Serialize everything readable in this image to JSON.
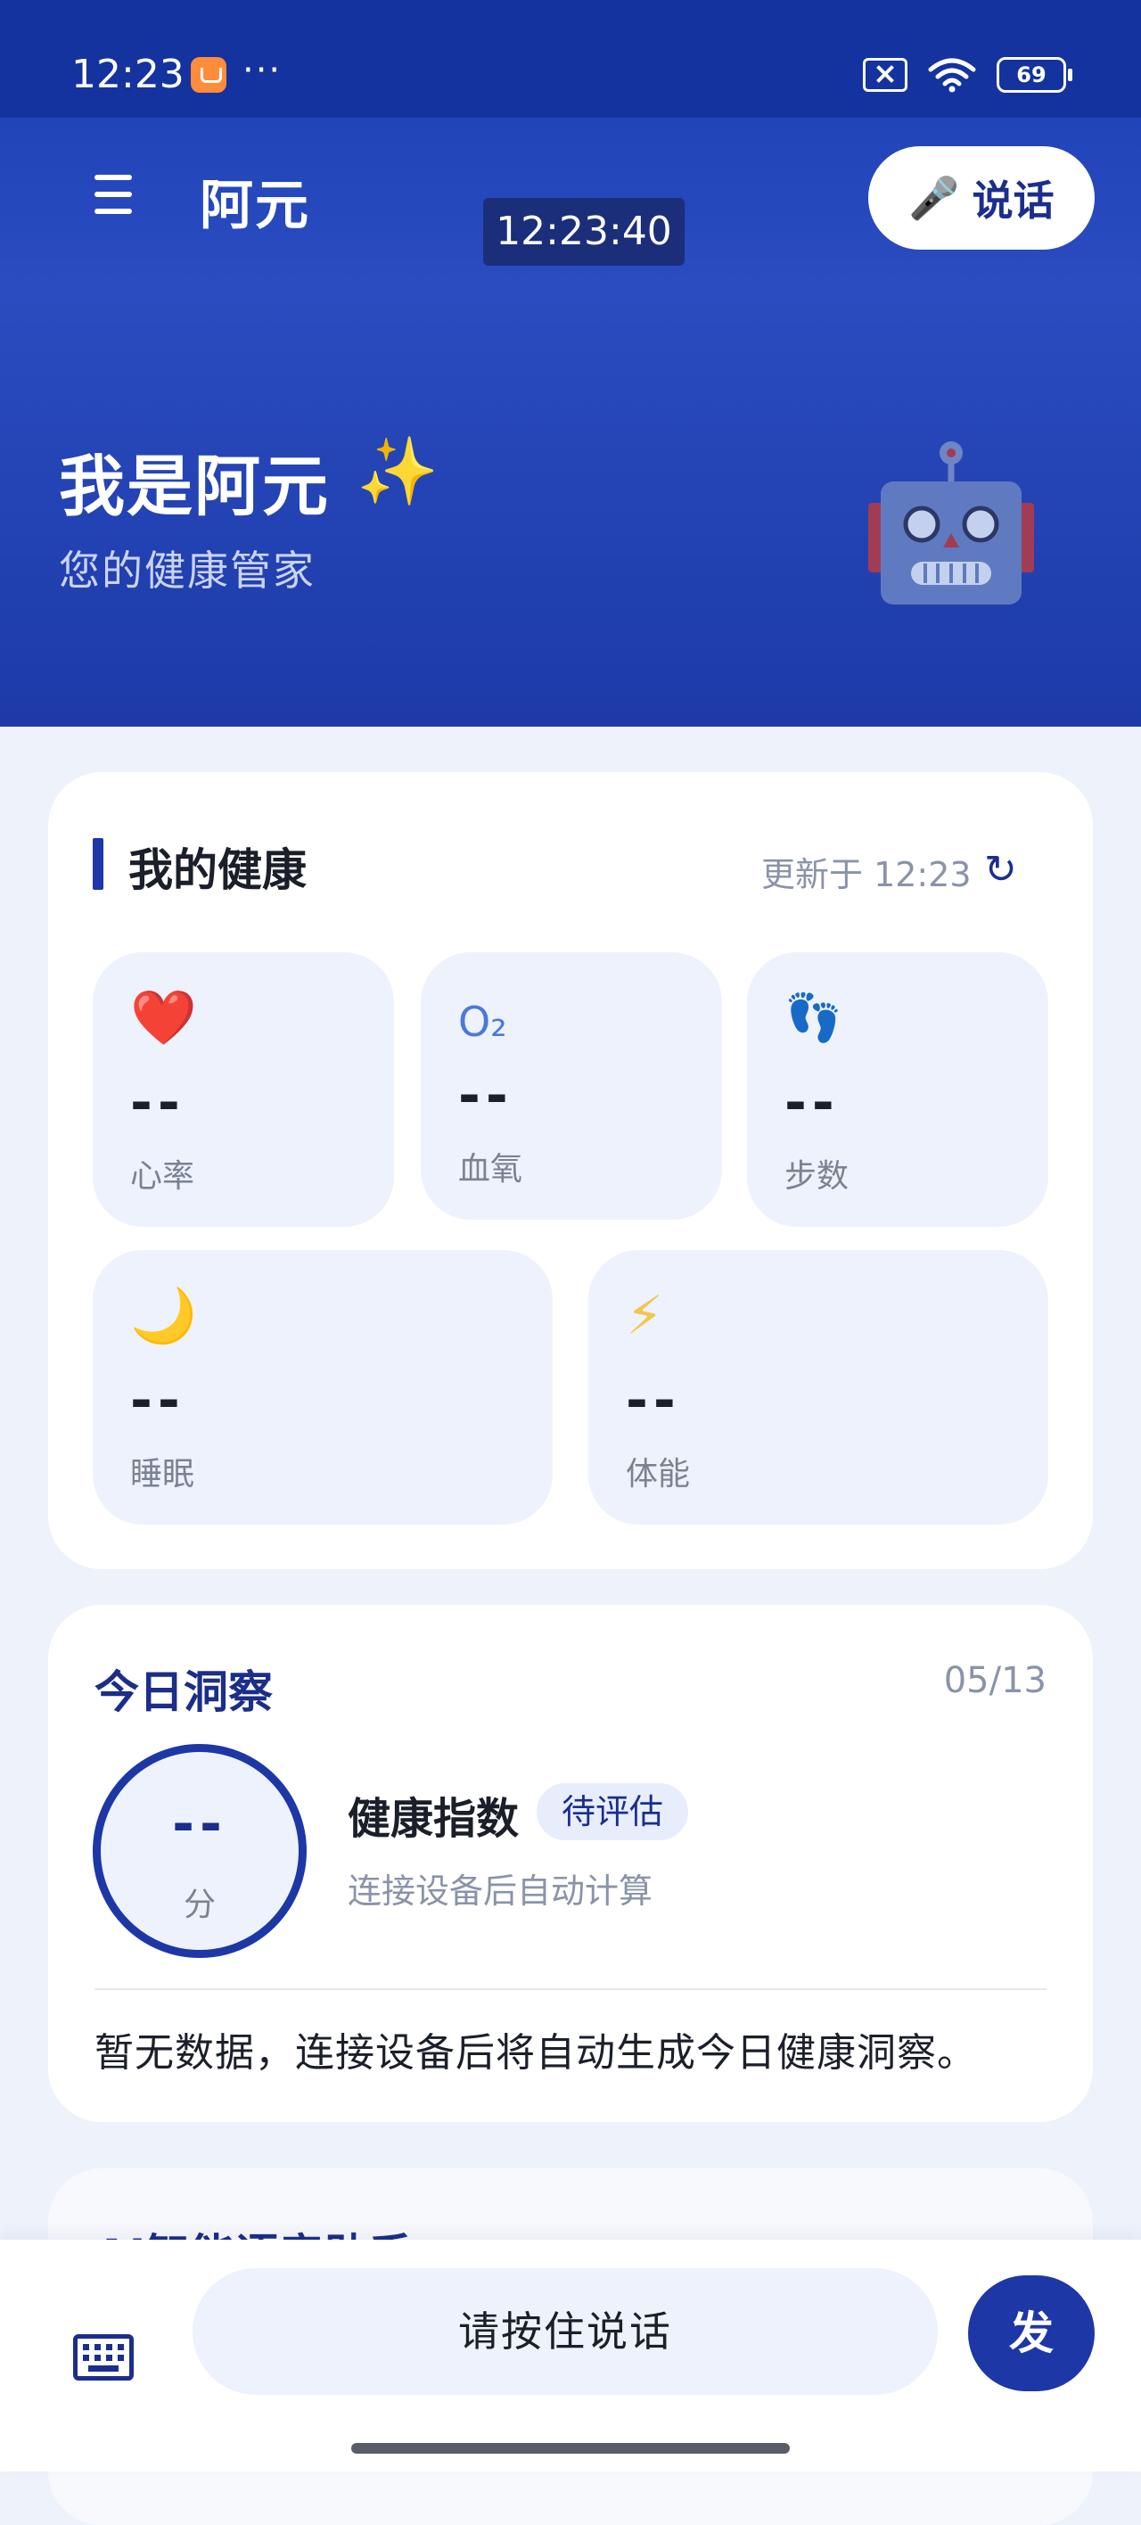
{
  "status_bar": {
    "time": "12:23",
    "dots": "···",
    "battery": "69"
  },
  "header": {
    "title": "阿元",
    "clock": "12:23:40",
    "talk_label": "说话"
  },
  "hero": {
    "title": "我是阿元",
    "sparkle": "✨",
    "subtitle": "您的健康管家"
  },
  "health": {
    "title": "我的健康",
    "updated": "更新于 12:23",
    "refresh_glyph": "↻",
    "metrics": [
      {
        "icon": "❤️",
        "value": "--",
        "label": "心率"
      },
      {
        "icon": "O₂",
        "value": "--",
        "label": "血氧"
      },
      {
        "icon": "👣",
        "value": "--",
        "label": "步数"
      },
      {
        "icon": "🌙",
        "value": "--",
        "label": "睡眠"
      },
      {
        "icon": "⚡",
        "value": "--",
        "label": "体能"
      }
    ]
  },
  "insight": {
    "title": "今日洞察",
    "date": "05/13",
    "score": "--",
    "score_unit": "分",
    "index_title": "健康指数",
    "badge": "待评估",
    "index_sub": "连接设备后自动计算",
    "message": "暂无数据，连接设备后将自动生成今日健康洞察。"
  },
  "ai": {
    "title": "AI智能语音助手"
  },
  "bottom": {
    "hold_label": "请按住说话",
    "send_label": "发"
  },
  "colors": {
    "brand": "#1d37a7",
    "hero": "#1b3fb3",
    "card_bg": "#eef2fc"
  }
}
